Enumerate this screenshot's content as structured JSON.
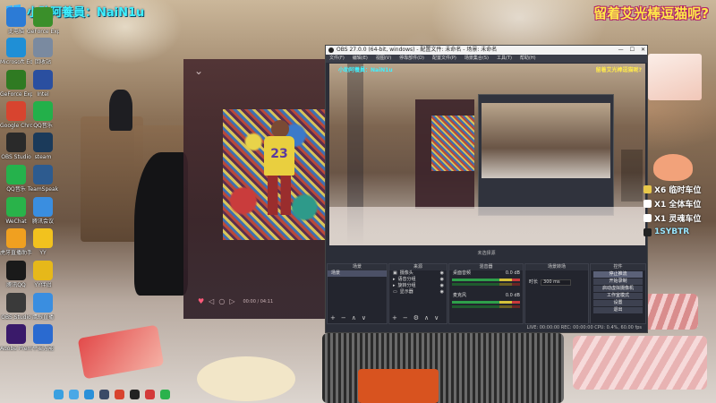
{
  "overlay": {
    "top_left_caption": "小助阿養員：NaiN1u",
    "top_right_caption": "留着艾光棒逗猫呢?"
  },
  "desktop_icons": [
    {
      "label": "此电脑",
      "icon": "computer-icon",
      "color": "#2c7bd6"
    },
    {
      "label": "GeForce Experience",
      "icon": "nvidia-icon",
      "color": "#3a8f2a"
    },
    {
      "label": "Microsoft Edge",
      "icon": "edge-icon",
      "color": "#1f8fd6"
    },
    {
      "label": "回收站",
      "icon": "recycle-bin-icon",
      "color": "#7a8aa0"
    },
    {
      "label": "GeForce Experience",
      "icon": "nvidia-icon",
      "color": "#2f7a22"
    },
    {
      "label": "Intel",
      "icon": "intel-icon",
      "color": "#2a4fa0"
    },
    {
      "label": "Google Chrome",
      "icon": "chrome-icon",
      "color": "#d8442f"
    },
    {
      "label": "QQ音乐",
      "icon": "qq-music-icon",
      "color": "#23b04a"
    },
    {
      "label": "OBS Studio",
      "icon": "obs-icon",
      "color": "#2a2a2a"
    },
    {
      "label": "steam",
      "icon": "steam-icon",
      "color": "#1b3a5a"
    },
    {
      "label": "QQ音乐",
      "icon": "music-icon",
      "color": "#25b24c"
    },
    {
      "label": "TeamSpeak",
      "icon": "teamspeak-icon",
      "color": "#2d5b8f"
    },
    {
      "label": "WeChat",
      "icon": "wechat-icon",
      "color": "#29b34a"
    },
    {
      "label": "腾讯会议",
      "icon": "meeting-icon",
      "color": "#3a8ee0"
    },
    {
      "label": "虎牙直播助手",
      "icon": "huya-icon",
      "color": "#f0a020"
    },
    {
      "label": "YY",
      "icon": "yy-icon",
      "color": "#f2c21e"
    },
    {
      "label": "腾讯QQ",
      "icon": "qq-icon",
      "color": "#1a1a1a"
    },
    {
      "label": "YY伴侣",
      "icon": "yy-companion-icon",
      "color": "#e6b81a"
    },
    {
      "label": "OBS Studio",
      "icon": "obs-icon",
      "color": "#3a3a3a"
    },
    {
      "label": "鹰眼直播",
      "icon": "eagle-icon",
      "color": "#3a8ee0"
    },
    {
      "label": "Adobe Premiere",
      "icon": "premiere-icon",
      "color": "#3a1a6a"
    },
    {
      "label": "平安万能",
      "icon": "shield-icon",
      "color": "#2a6ad0"
    }
  ],
  "player": {
    "collapse_glyph": "⌄",
    "jersey_number": "23",
    "controls": [
      "♥",
      "◁",
      "○",
      "▷"
    ],
    "time": "00:00 / 04:11"
  },
  "obs": {
    "title": "OBS 27.0.0 (64-bit, windows) - 配置文件: 未命名 - 场景: 未命名",
    "window_buttons": [
      "—",
      "☐",
      "✕"
    ],
    "menu": [
      "文件(F)",
      "编辑(E)",
      "视图(V)",
      "停靠部件(D)",
      "配置文件(P)",
      "场景集合(S)",
      "工具(T)",
      "帮助(H)"
    ],
    "preview_caption_left": "小助阿養員：NaiN1u",
    "preview_caption_right": "留着艾光棒逗猫呢?",
    "status_line": "未选择源",
    "docks": {
      "scenes": {
        "title": "场景",
        "items": [
          "场景"
        ]
      },
      "sources": {
        "title": "来源",
        "items": [
          "摄像头",
          "语音分组",
          "旋转分组",
          "显示器"
        ]
      },
      "mixer": {
        "title": "混音器",
        "tracks": [
          {
            "name": "桌面音频",
            "db": "0.0 dB"
          },
          {
            "name": "麦克风",
            "db": "0.0 dB"
          }
        ]
      },
      "transitions": {
        "title": "场景转场",
        "duration_label": "时长",
        "duration_value": "300 ms"
      },
      "controls": {
        "title": "控件",
        "buttons": [
          "停止推流",
          "开始录制",
          "启动虚拟摄像机",
          "工作室模式",
          "设置",
          "退出"
        ]
      }
    },
    "statusbar": "LIVE: 00:00:00   REC: 00:00:00   CPU: 0.4%, 60.00 fps"
  },
  "chat": [
    {
      "text": "X6 临时车位",
      "icon_color": "#e8c84a"
    },
    {
      "text": "X1 全体车位",
      "icon_color": "#ffffff"
    },
    {
      "text": "X1 灵魂车位",
      "icon_color": "#ffffff"
    },
    {
      "text": "1SYBTR",
      "icon_color": "#222222"
    }
  ],
  "taskbar_icons": [
    {
      "icon": "start-icon",
      "color": "#3aa0e0"
    },
    {
      "icon": "file-explorer-icon",
      "color": "#4aa8e6"
    },
    {
      "icon": "edge-icon",
      "color": "#2a90d8"
    },
    {
      "icon": "steam-icon",
      "color": "#3a4a66"
    },
    {
      "icon": "chrome-icon",
      "color": "#d8442f"
    },
    {
      "icon": "obs-icon",
      "color": "#222222"
    },
    {
      "icon": "netease-music-icon",
      "color": "#d33a3a"
    },
    {
      "icon": "wechat-icon",
      "color": "#2bb24c"
    }
  ]
}
